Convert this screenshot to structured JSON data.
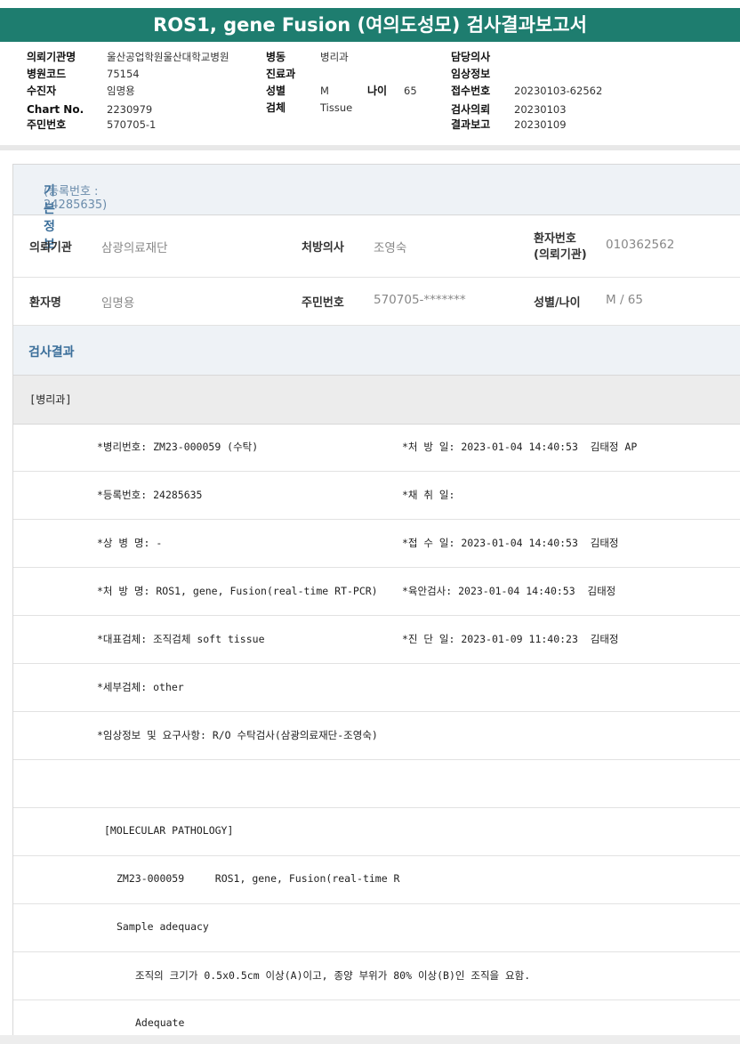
{
  "title": "ROS1, gene Fusion (여의도성모) 검사결과보고서",
  "header": {
    "col1": [
      {
        "label": "의뢰기관명",
        "value": "울산공업학원울산대학교병원"
      },
      {
        "label": "병원코드",
        "value": "75154"
      },
      {
        "label": "수진자",
        "value": "임명용"
      },
      {
        "label": "Chart No.",
        "value": "2230979"
      },
      {
        "label": "주민번호",
        "value": "570705-1"
      }
    ],
    "col2": [
      {
        "label": "병동",
        "value": "병리과"
      },
      {
        "label": "진료과",
        "value": ""
      },
      {
        "label": "성별",
        "value": "M"
      },
      {
        "label": "검체",
        "value": "Tissue"
      }
    ],
    "age_label": "나이",
    "age_value": "65",
    "col3": [
      {
        "label": "담당의사",
        "value": ""
      },
      {
        "label": "임상정보",
        "value": ""
      },
      {
        "label": "접수번호",
        "value": "20230103-62562"
      },
      {
        "label": "검사의뢰",
        "value": "20230103"
      },
      {
        "label": "결과보고",
        "value": "20230109"
      }
    ]
  },
  "basic_info": {
    "heading": "기본정보",
    "reg_sub": "(등록번호 : 24285635)",
    "row1": {
      "inst_label": "의뢰기관",
      "inst_value": "삼광의료재단",
      "doctor_label": "처방의사",
      "doctor_value": "조영숙",
      "ptno_label_1": "환자번호",
      "ptno_label_2": "(의뢰기관)",
      "ptno_value": "010362562"
    },
    "row2": {
      "name_label": "환자명",
      "name_value": "임명용",
      "rrn_label": "주민번호",
      "rrn_value": "570705-*******",
      "sexage_label": "성별/나이",
      "sexage_value": "M / 65"
    }
  },
  "results": {
    "heading": "검사결과",
    "dept": "[병리과]",
    "lines": [
      {
        "left": "*병리번호: ZM23-000059 (수탁)",
        "right": "*처 방 일: 2023-01-04 14:40:53  김태정 AP"
      },
      {
        "left": "*등록번호: 24285635",
        "right": "*채 취 일:"
      },
      {
        "left": "*상 병 명: -",
        "right": "*접 수 일: 2023-01-04 14:40:53  김태정"
      },
      {
        "left": "*처 방 명: ROS1, gene, Fusion(real-time RT-PCR)",
        "right": "*육안검사: 2023-01-04 14:40:53  김태정"
      },
      {
        "left": "*대표검체: 조직검체 soft tissue",
        "right": "*진 단 일: 2023-01-09 11:40:23  김태정"
      },
      {
        "left": "*세부검체: other",
        "right": ""
      },
      {
        "left": "*임상정보 및 요구사항: R/O 수탁검사(삼광의료재단-조영숙)",
        "right": ""
      }
    ],
    "molecular_header": "[MOLECULAR PATHOLOGY]",
    "mol_line": "ZM23-000059     ROS1, gene, Fusion(real-time R",
    "sample_adequacy": "Sample adequacy",
    "size_note": "조직의 크기가 0.5x0.5cm 이상(A)이고, 종양 부위가 80% 이상(B)인 조직을 요함.",
    "adequate": "Adequate"
  },
  "colors": {
    "title_bar": "#1e7d6f",
    "section_text": "#3a6e9a",
    "section_bg": "#eef2f6"
  }
}
